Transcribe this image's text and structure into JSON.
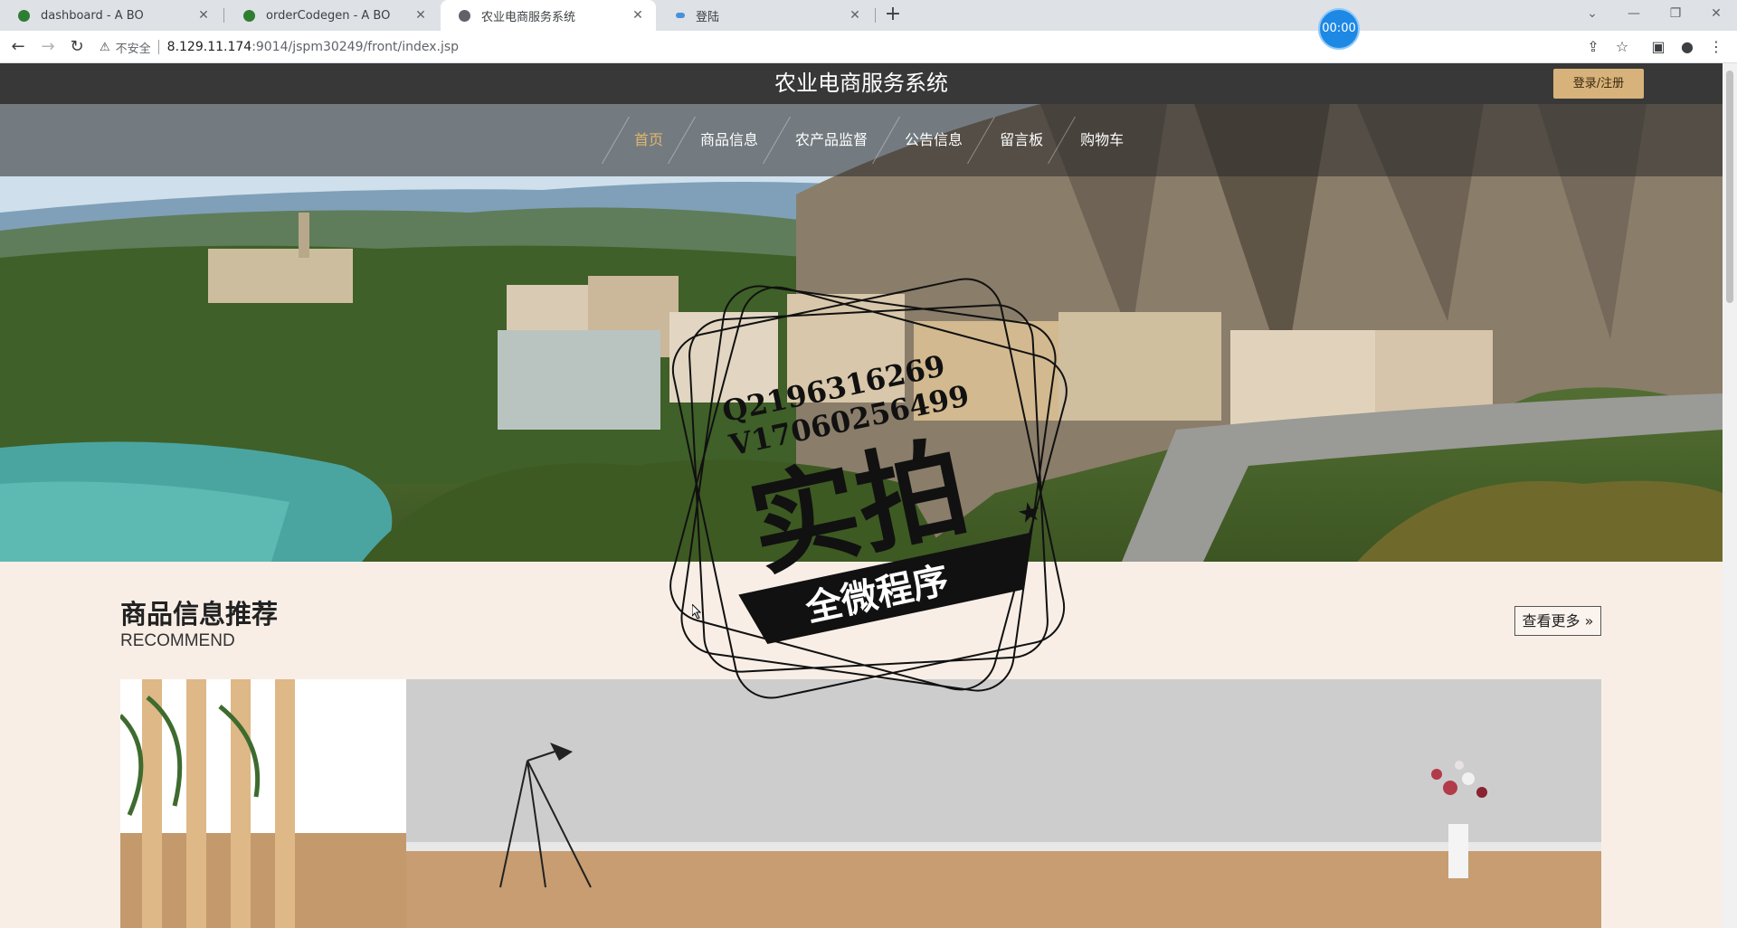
{
  "browser": {
    "tabs": [
      {
        "title": "dashboard - A BO",
        "favicon_color": "#2e7d32"
      },
      {
        "title": "orderCodegen - A BO",
        "favicon_color": "#2e7d32"
      },
      {
        "title": "农业电商服务系统",
        "favicon_color": "#5f6368"
      },
      {
        "title": "登陆",
        "favicon_color": "#4a90d9"
      }
    ],
    "timer": "00:00",
    "address": {
      "insecure_label": "不安全",
      "host": "8.129.11.174",
      "rest": ":9014/jspm30249/front/index.jsp"
    }
  },
  "site": {
    "title": "农业电商服务系统",
    "login_label": "登录/注册",
    "nav": [
      {
        "label": "首页",
        "active": true
      },
      {
        "label": "商品信息",
        "active": false
      },
      {
        "label": "农产品监督",
        "active": false
      },
      {
        "label": "公告信息",
        "active": false
      },
      {
        "label": "留言板",
        "active": false
      },
      {
        "label": "购物车",
        "active": false
      }
    ],
    "accent_color": "#e0b56d"
  },
  "recommend": {
    "title": "商品信息推荐",
    "subtitle": "RECOMMEND",
    "more_label": "查看更多 »"
  },
  "watermark": {
    "line1": "Q2196316269",
    "line2": "V17060256499",
    "big": "实拍",
    "banner": "全微程序"
  }
}
